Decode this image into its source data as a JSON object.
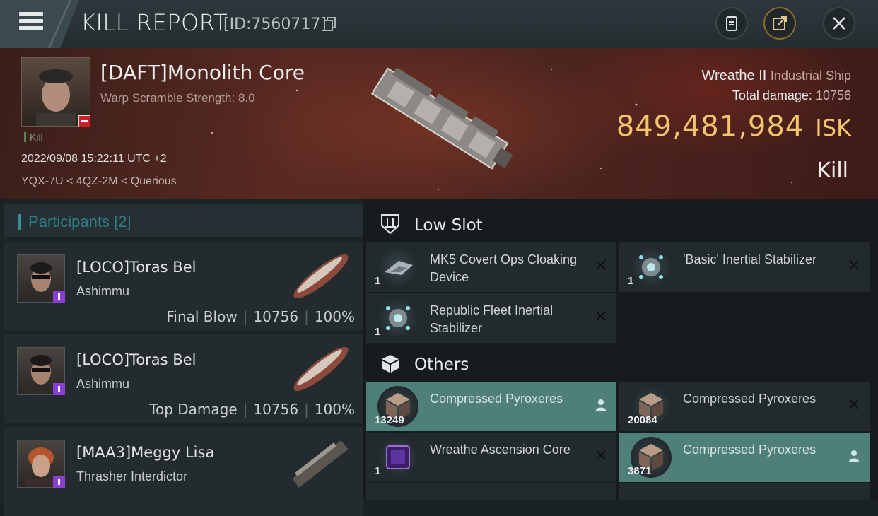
{
  "header": {
    "menu_icon": "hamburger-icon",
    "title": "KILL REPORT",
    "report_id": "[ID:7560717]",
    "copy_icon": "copy-icon",
    "buttons": [
      "clipboard-icon",
      "share-icon",
      "close-icon"
    ]
  },
  "victim": {
    "name": "[DAFT]Monolith Core",
    "subtitle": "Warp Scramble Strength: 8.0",
    "tag": "Kill",
    "datetime": "2022/09/08 15:22:11 UTC +2",
    "location": "YQX-7U < 4QZ-2M < Querious",
    "ship_name": "Wreathe II",
    "ship_class": "Industrial Ship",
    "total_damage_label": "Total damage:",
    "total_damage": "10756",
    "isk_value": "849,481,984",
    "isk_unit": "ISK",
    "kill_type": "Kill"
  },
  "participants": {
    "title": "Participants",
    "count": "[2]",
    "rows": [
      {
        "name": "[LOCO]Toras Bel",
        "ship": "Ashimmu",
        "role": "Final Blow",
        "damage": "10756",
        "percent": "100%"
      },
      {
        "name": "[LOCO]Toras Bel",
        "ship": "Ashimmu",
        "role": "Top Damage",
        "damage": "10756",
        "percent": "100%"
      },
      {
        "name": "[MAA3]Meggy Lisa",
        "ship": "Thrasher Interdictor",
        "role": "",
        "damage": "",
        "percent": ""
      }
    ]
  },
  "low_slot": {
    "title": "Low Slot",
    "items": [
      {
        "qty": "1",
        "name": "MK5 Covert Ops Cloaking Device"
      },
      {
        "qty": "1",
        "name": "'Basic' Inertial Stabilizer"
      },
      {
        "qty": "1",
        "name": "Republic Fleet Inertial Stabilizer"
      }
    ]
  },
  "others": {
    "title": "Others",
    "items": [
      {
        "qty": "13249",
        "name": "Compressed Pyroxeres",
        "highlight": true
      },
      {
        "qty": "20084",
        "name": "Compressed Pyroxeres",
        "highlight": false
      },
      {
        "qty": "1",
        "name": "Wreathe Ascension Core",
        "highlight": false
      },
      {
        "qty": "3871",
        "name": "Compressed Pyroxeres",
        "highlight": true
      }
    ]
  },
  "colors": {
    "isk_gold": "#f3c56d",
    "highlight_teal": "#4e7f78",
    "accent_teal": "#2e7f86",
    "hero_red": "#5a2a22"
  }
}
